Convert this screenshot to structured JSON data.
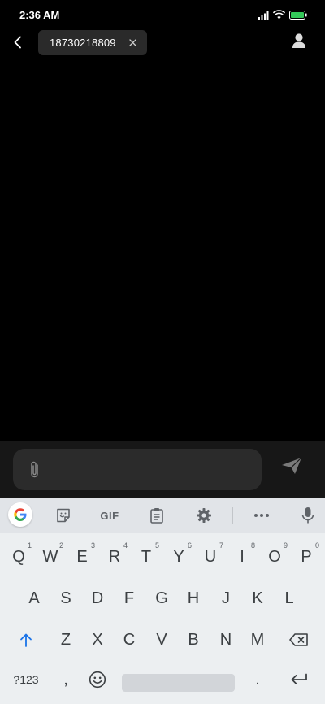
{
  "status_bar": {
    "time": "2:36 AM"
  },
  "header": {
    "recipient": "18730218809",
    "icons": [
      "back-arrow-icon",
      "close-icon",
      "contact-person-icon"
    ]
  },
  "compose": {
    "icons": [
      "paperclip-icon",
      "send-icon"
    ]
  },
  "keyboard": {
    "toolbar": {
      "gif_label": "GIF",
      "icons": [
        "google-g-icon",
        "sticker-icon",
        "clipboard-icon",
        "gear-icon",
        "more-icon",
        "microphone-icon"
      ]
    },
    "row1": [
      {
        "label": "Q",
        "hint": "1"
      },
      {
        "label": "W",
        "hint": "2"
      },
      {
        "label": "E",
        "hint": "3"
      },
      {
        "label": "R",
        "hint": "4"
      },
      {
        "label": "T",
        "hint": "5"
      },
      {
        "label": "Y",
        "hint": "6"
      },
      {
        "label": "U",
        "hint": "7"
      },
      {
        "label": "I",
        "hint": "8"
      },
      {
        "label": "O",
        "hint": "9"
      },
      {
        "label": "P",
        "hint": "0"
      }
    ],
    "row2": [
      "A",
      "S",
      "D",
      "F",
      "G",
      "H",
      "J",
      "K",
      "L"
    ],
    "row3": [
      "Z",
      "X",
      "C",
      "V",
      "B",
      "N",
      "M"
    ],
    "bottom": {
      "symbols": "?123",
      "comma": ",",
      "period": "."
    },
    "colors": {
      "shift_blue": "#1a73e8",
      "key_text": "#3c4043"
    }
  }
}
